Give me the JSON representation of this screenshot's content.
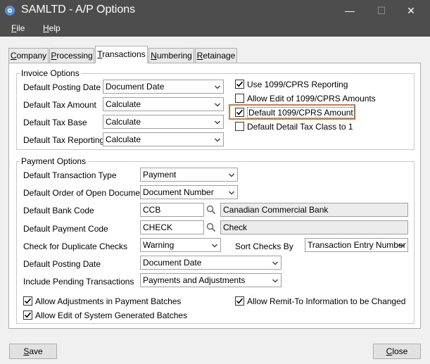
{
  "window": {
    "title": "SAMLTD - A/P Options",
    "minimize": "—",
    "maximize": "☐",
    "close": "✕"
  },
  "menu": [
    {
      "label_pre": "",
      "accel": "F",
      "label_post": "ile"
    },
    {
      "label_pre": "",
      "accel": "H",
      "label_post": "elp"
    }
  ],
  "tabs": [
    {
      "accel": "C",
      "rest": "ompany",
      "active": false
    },
    {
      "accel": "P",
      "rest": "rocessing",
      "active": false
    },
    {
      "accel": "T",
      "rest": "ransactions",
      "active": true
    },
    {
      "accel": "N",
      "rest": "umbering",
      "active": false
    },
    {
      "accel": "R",
      "rest": "etainage",
      "active": false
    }
  ],
  "invoice_options": {
    "legend": "Invoice Options",
    "posting_date_label": "Default Posting Date",
    "posting_date_value": "Document Date",
    "tax_amount_label": "Default Tax Amount",
    "tax_amount_value": "Calculate",
    "tax_base_label": "Default Tax Base",
    "tax_base_value": "Calculate",
    "tax_reporting_label": "Default Tax Reporting",
    "tax_reporting_value": "Calculate",
    "use_1099_label": "Use 1099/CPRS Reporting",
    "use_1099_checked": true,
    "allow_edit_1099_label": "Allow Edit of 1099/CPRS Amounts",
    "allow_edit_1099_checked": false,
    "default_1099_amount_label": "Default 1099/CPRS Amount",
    "default_1099_amount_checked": true,
    "default_detail_tax_label": "Default Detail Tax Class to 1",
    "default_detail_tax_checked": false
  },
  "payment_options": {
    "legend": "Payment Options",
    "txn_type_label": "Default Transaction Type",
    "txn_type_value": "Payment",
    "order_label": "Default Order of Open Documents",
    "order_value": "Document Number",
    "bank_code_label": "Default Bank Code",
    "bank_code_value": "CCB",
    "bank_code_desc": "Canadian Commercial Bank",
    "payment_code_label": "Default Payment Code",
    "payment_code_value": "CHECK",
    "payment_code_desc": "Check",
    "dup_checks_label": "Check for Duplicate Checks",
    "dup_checks_value": "Warning",
    "sort_checks_label": "Sort Checks By",
    "sort_checks_value": "Transaction Entry Number",
    "posting_date_label": "Default Posting Date",
    "posting_date_value": "Document Date",
    "pending_label": "Include Pending Transactions",
    "pending_value": "Payments and Adjustments",
    "allow_adjustments_label": "Allow Adjustments in Payment Batches",
    "allow_adjustments_checked": true,
    "allow_edit_system_label": "Allow Edit of System Generated Batches",
    "allow_edit_system_checked": true,
    "allow_remit_label": "Allow Remit-To Information to be Changed",
    "allow_remit_checked": true
  },
  "buttons": {
    "save_accel": "S",
    "save_rest": "ave",
    "close_accel": "C",
    "close_rest": "lose"
  },
  "colors": {
    "titlebar": "#4d4d4d",
    "highlight_border": "#c87c4c"
  }
}
